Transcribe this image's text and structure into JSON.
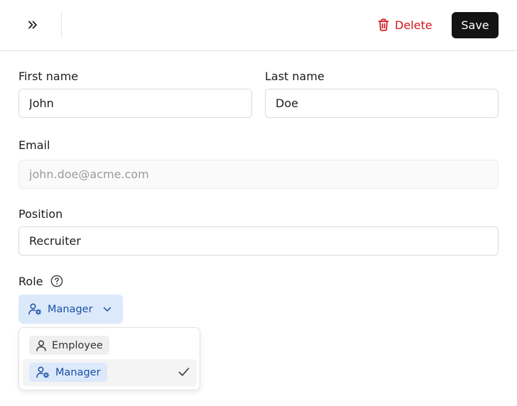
{
  "toolbar": {
    "collapse_icon": "chevrons-right-icon",
    "delete_label": "Delete",
    "delete_icon": "trash-icon",
    "save_label": "Save",
    "colors": {
      "delete": "#d3141a",
      "save_bg": "#131313"
    }
  },
  "form": {
    "first_name": {
      "label": "First name",
      "value": "John"
    },
    "last_name": {
      "label": "Last name",
      "value": "Doe"
    },
    "email": {
      "label": "Email",
      "placeholder": "john.doe@acme.com"
    },
    "position": {
      "label": "Position",
      "value": "Recruiter"
    },
    "role": {
      "label": "Role",
      "help_icon": "question-circle-icon",
      "selected": "Manager",
      "selected_icon": "user-cog-icon",
      "options": [
        {
          "label": "Employee",
          "icon": "user-icon",
          "selected": false
        },
        {
          "label": "Manager",
          "icon": "user-cog-icon",
          "selected": true
        }
      ],
      "colors": {
        "chip_bg": "#dbe9fb",
        "chip_text": "#1b4fa3"
      }
    }
  }
}
